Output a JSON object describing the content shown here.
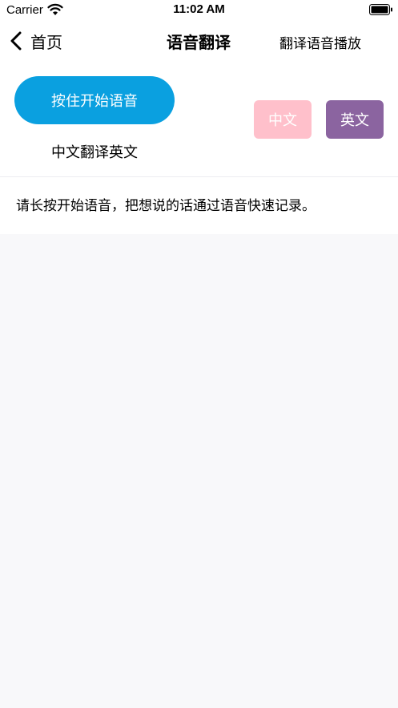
{
  "status_bar": {
    "carrier": "Carrier",
    "time": "11:02 AM",
    "icons": [
      "wifi-icon",
      "battery-icon"
    ]
  },
  "nav": {
    "back_label": "首页",
    "title": "语音翻译",
    "right_button": "翻译语音播放",
    "back_icon": "chevron-left-icon"
  },
  "controls": {
    "record_button": "按住开始语音",
    "direction_label": "中文翻译英文",
    "lang_zh": "中文",
    "lang_en": "英文"
  },
  "result": {
    "text": "请长按开始语音，把想说的话通过语音快速记录。"
  },
  "colors": {
    "record_button": "#0aa0e0",
    "lang_zh_bg": "#ffc0cb",
    "lang_en_bg": "#8b64a0",
    "page_bg": "#f8f8fa"
  }
}
